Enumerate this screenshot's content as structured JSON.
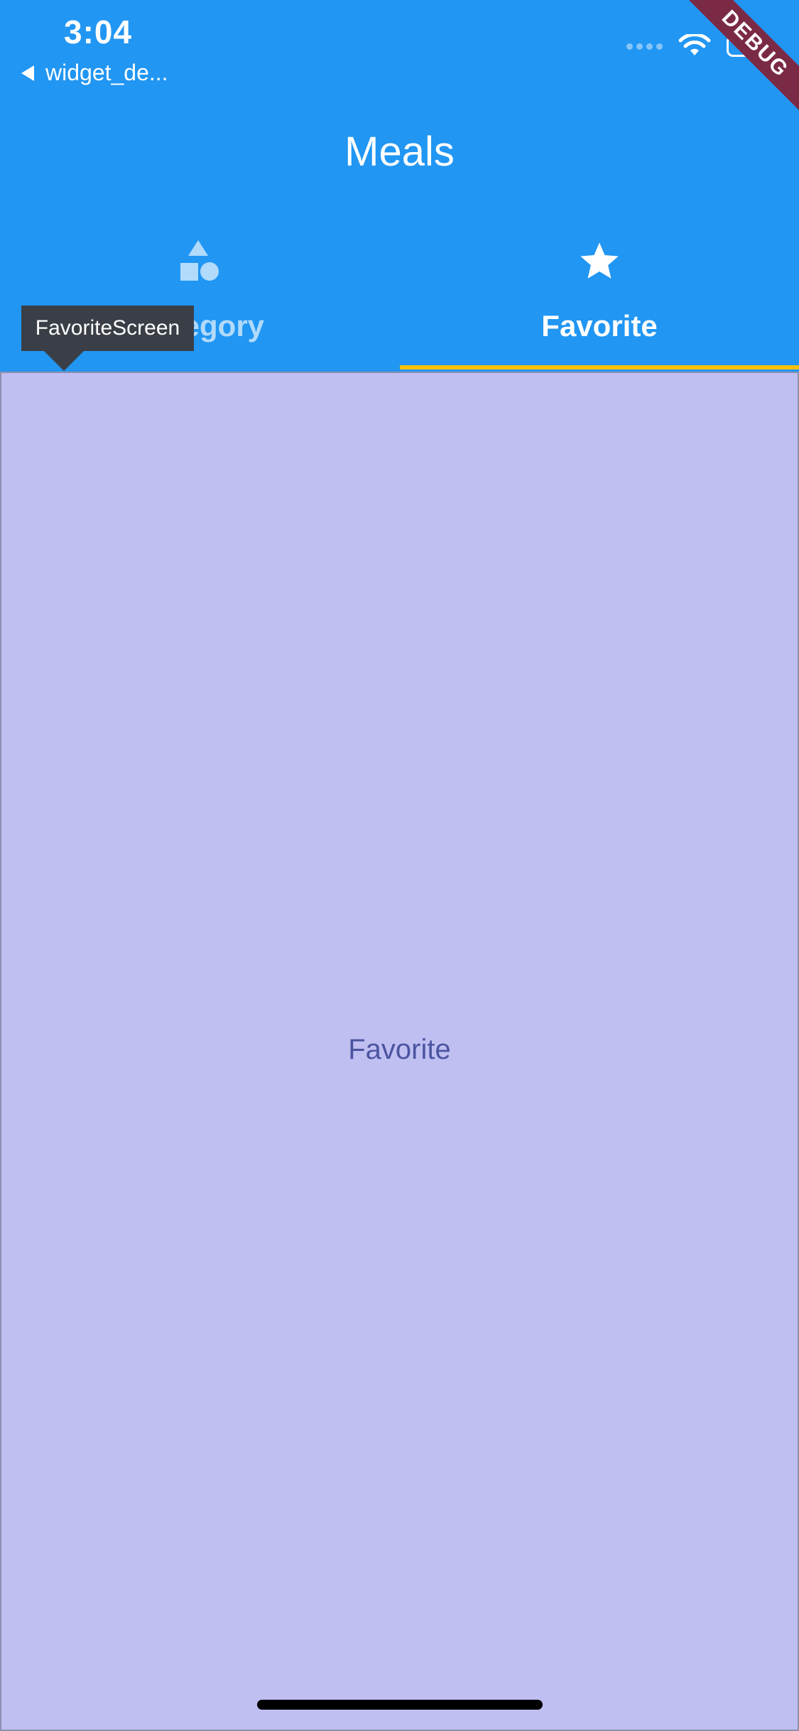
{
  "status_bar": {
    "time": "3:04",
    "back_app_label": "widget_de..."
  },
  "app_bar": {
    "title": "Meals",
    "background_color": "#2196F3"
  },
  "tabs": [
    {
      "label": "Category",
      "icon": "category-shapes-icon",
      "selected": false
    },
    {
      "label": "Favorite",
      "icon": "star-icon",
      "selected": true
    }
  ],
  "tab_indicator_color": "#FFC107",
  "body": {
    "text": "Favorite",
    "background_color": "#C0BFF2"
  },
  "tooltip": {
    "text": "FavoriteScreen"
  },
  "debug_banner": {
    "text": "DEBUG"
  }
}
